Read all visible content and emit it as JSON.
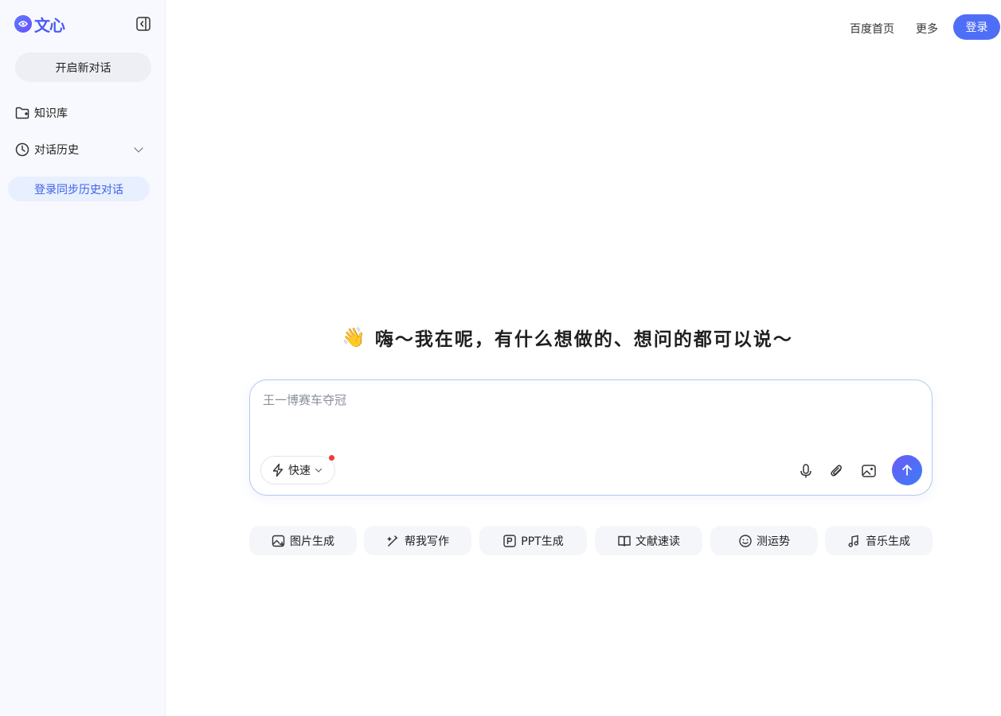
{
  "brand": {
    "name": "文心",
    "accent": "#4f6ef7"
  },
  "sidebar": {
    "new_chat_label": "开启新对话",
    "items": [
      {
        "label": "知识库",
        "icon": "folder-icon"
      },
      {
        "label": "对话历史",
        "icon": "clock-icon"
      }
    ],
    "sync_label": "登录同步历史对话"
  },
  "header": {
    "links": [
      "百度首页",
      "更多"
    ],
    "login_label": "登录"
  },
  "main": {
    "wave_emoji": "👋",
    "greeting": "嗨～我在呢，有什么想做的、想问的都可以说～",
    "input": {
      "placeholder": "王一博赛车夺冠",
      "mode_label": "快速"
    },
    "quick_actions": [
      {
        "label": "图片生成",
        "icon": "image-gen-icon"
      },
      {
        "label": "帮我写作",
        "icon": "pen-icon"
      },
      {
        "label": "PPT生成",
        "icon": "ppt-icon"
      },
      {
        "label": "文献速读",
        "icon": "book-icon"
      },
      {
        "label": "测运势",
        "icon": "smile-icon"
      },
      {
        "label": "音乐生成",
        "icon": "music-icon"
      }
    ]
  }
}
